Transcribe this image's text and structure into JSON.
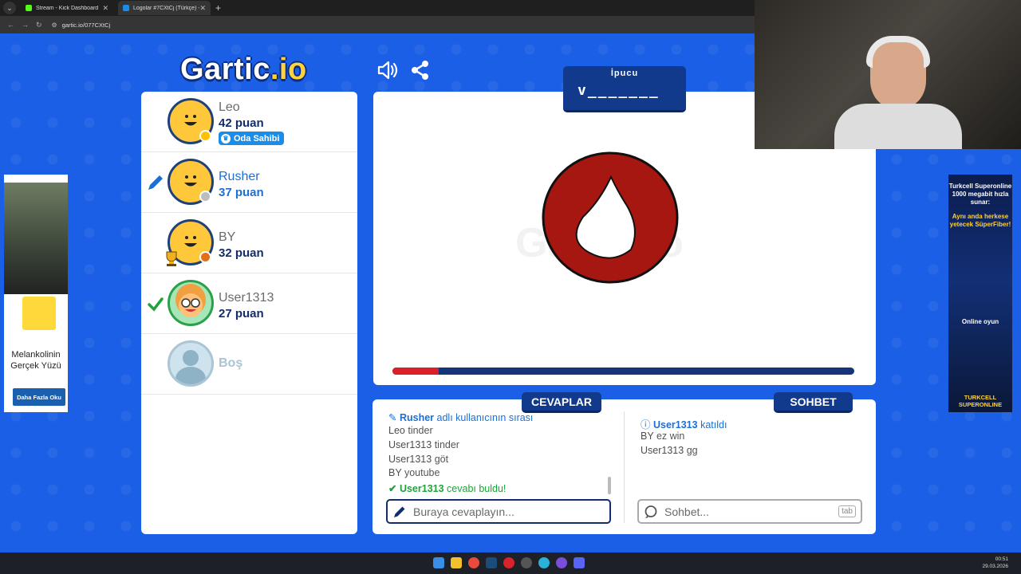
{
  "browser": {
    "tabs": [
      {
        "title": "Stream - Kick Dashboard",
        "favicon_color": "#53fc18",
        "active": false
      },
      {
        "title": "Logolar #7CXtCj (Türkçe) - Gartic",
        "favicon_color": "#1b8de8",
        "active": true
      }
    ],
    "url": "gartic.io/077CXtCj"
  },
  "game": {
    "logo_main": "Gartic",
    "logo_suffix": ".io",
    "hint_label": "İpucu",
    "hint_word": "v_______",
    "timer_progress": 0.1
  },
  "players": [
    {
      "name": "Leo",
      "score": "42 puan",
      "badge": "Oda Sahibi",
      "dot_color": "#ffc107"
    },
    {
      "name": "Rusher",
      "score": "37 puan",
      "drawing": true,
      "dot_color": "#bdbdbd"
    },
    {
      "name": "BY",
      "score": "32 puan",
      "dot_color": "#e0701c",
      "trophy": true
    },
    {
      "name": "User1313",
      "score": "27 puan",
      "guessed": true
    },
    {
      "name": "Boş",
      "score": ""
    }
  ],
  "answers": {
    "tab_label": "CEVAPLAR",
    "messages": [
      {
        "user": "Rusher",
        "text": "adlı kullanıcının sırası"
      },
      {
        "user": "Leo",
        "text": "tinder"
      },
      {
        "user": "User1313",
        "text": "tinder"
      },
      {
        "user": "User1313",
        "text": "göt"
      },
      {
        "user": "BY",
        "text": "youtube"
      },
      {
        "user": "User1313",
        "text": "cevabı buldu!"
      }
    ],
    "placeholder": "Buraya cevaplayın..."
  },
  "chat": {
    "tab_label": "SOHBET",
    "messages": [
      {
        "user": "User1313",
        "text": "katıldı"
      },
      {
        "user": "BY",
        "text": "ez win"
      },
      {
        "user": "User1313",
        "text": "gg"
      }
    ],
    "placeholder": "Sohbet...",
    "tab_key": "tab"
  },
  "ads": {
    "left": {
      "text_line1": "Melankolinin",
      "text_line2": "Gerçek Yüzü",
      "button": "Daha Fazla Oku"
    },
    "right": {
      "line1": "Turkcell Superonline 1000 megabit hızla sunar:",
      "line2": "Aynı anda herkese yetecek SüperFiber!",
      "line3": "Online oyun",
      "brand": "TURKCELL SUPERONLINE"
    }
  },
  "taskbar": {
    "time": "00:51",
    "date": "29.03.2026"
  }
}
